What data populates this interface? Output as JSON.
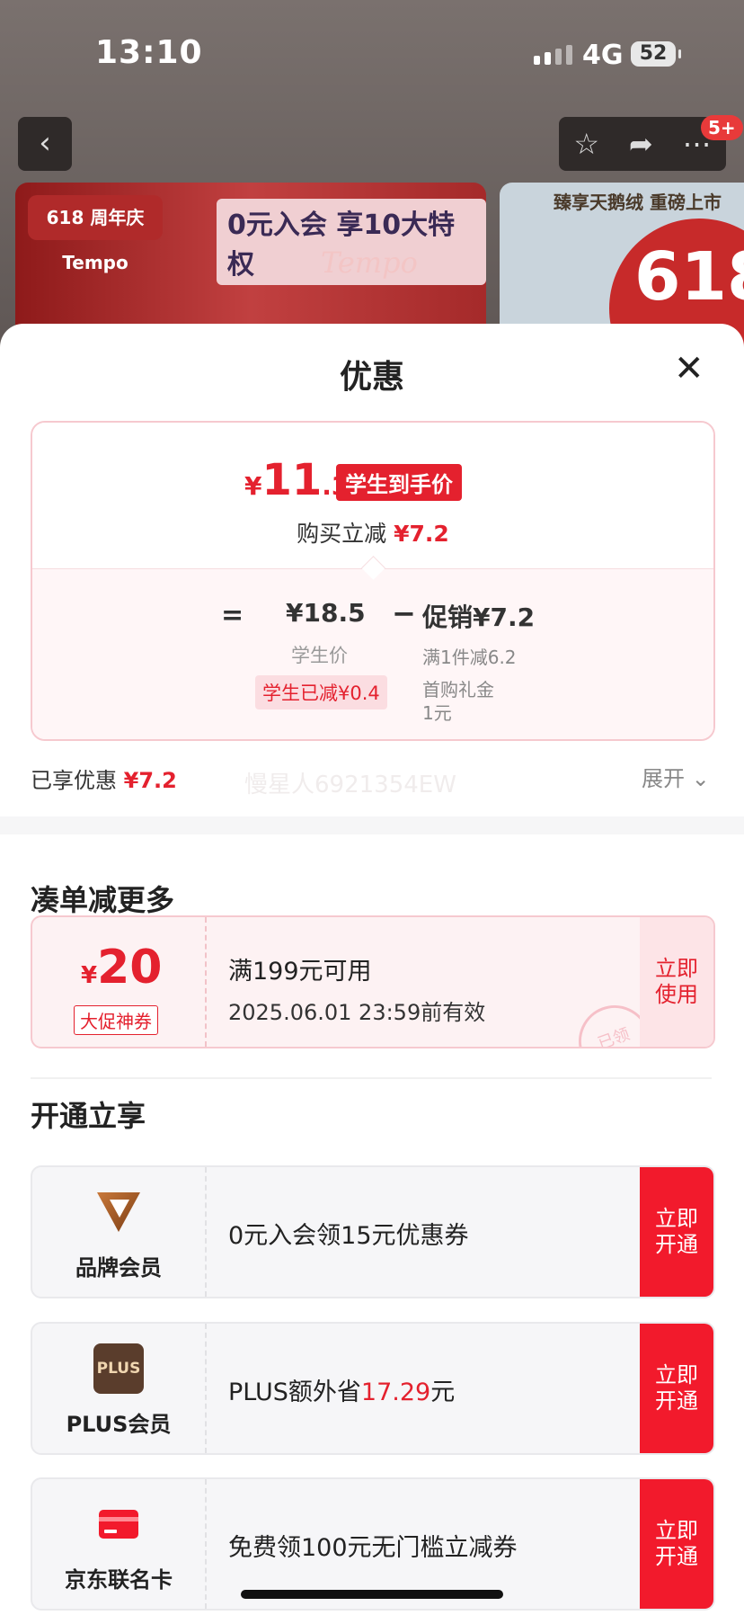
{
  "status": {
    "time": "13:10",
    "network": "4G",
    "battery": "52"
  },
  "nav": {
    "badge": "5+"
  },
  "banner": {
    "left_logo": "618 周年庆 Tempo",
    "left_headline": "0元入会 享10大特权",
    "left_watermark": "Tempo",
    "right_headline": "臻享天鹅绒 重磅上市",
    "right_badge": "618"
  },
  "sheet": {
    "title": "优惠"
  },
  "calc": {
    "currency": "¥",
    "price_int": "11",
    "price_dec": ".3",
    "price_tag": "学生到手价",
    "cut_label": "购买立减",
    "cut_value": "¥7.2",
    "eq": "=",
    "student_price": "¥18.5",
    "student_label": "学生价",
    "student_cut": "学生已减¥0.4",
    "minus": "−",
    "promo": "促销¥7.2",
    "promo_line1": "满1件减6.2",
    "promo_line2": "首购礼金",
    "promo_line3": "1元"
  },
  "summary": {
    "label": "已享优惠",
    "value": "¥7.2",
    "watermark": "慢星人6921354EW",
    "expand": "展开"
  },
  "sections": {
    "more": "凑单减更多",
    "open": "开通立享"
  },
  "coupon": {
    "currency": "¥",
    "amount": "20",
    "tag": "大促神券",
    "condition": "满199元可用",
    "expiry": "2025.06.01 23:59前有效",
    "button": "立即使用",
    "stamp": "已领"
  },
  "memberships": [
    {
      "label": "品牌会员",
      "text": "0元入会领15元优惠券",
      "button": "立即开通"
    },
    {
      "label": "PLUS会员",
      "icon_text": "PLUS",
      "text_prefix": "PLUS额外省",
      "highlight": "17.29",
      "text_suffix": "元",
      "button": "立即开通"
    },
    {
      "label": "京东联名卡",
      "text": "免费领100元无门槛立减券",
      "button": "立即开通"
    }
  ],
  "colors": {
    "accent": "#e4212e",
    "button_red": "#f21a2c"
  }
}
